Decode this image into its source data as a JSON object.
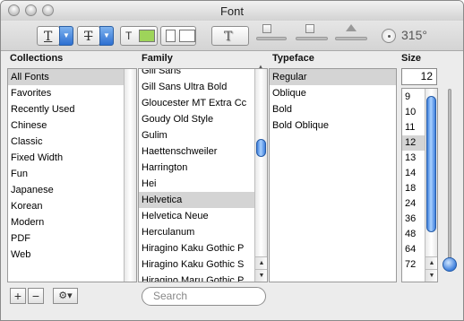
{
  "window": {
    "title": "Font"
  },
  "toolbar": {
    "rotation_label": "315°"
  },
  "columns": {
    "collections": "Collections",
    "family": "Family",
    "typeface": "Typeface",
    "size": "Size"
  },
  "collections": [
    {
      "label": "All Fonts",
      "selected": true
    },
    {
      "label": "Favorites"
    },
    {
      "label": "Recently Used"
    },
    {
      "label": "Chinese"
    },
    {
      "label": "Classic"
    },
    {
      "label": "Fixed Width"
    },
    {
      "label": "Fun"
    },
    {
      "label": "Japanese"
    },
    {
      "label": "Korean"
    },
    {
      "label": "Modern"
    },
    {
      "label": "PDF"
    },
    {
      "label": "Web"
    }
  ],
  "families": [
    {
      "label": "Gill Sans"
    },
    {
      "label": "Gill Sans Ultra Bold"
    },
    {
      "label": "Gloucester MT Extra Cc"
    },
    {
      "label": "Goudy Old Style"
    },
    {
      "label": "Gulim"
    },
    {
      "label": "Haettenschweiler"
    },
    {
      "label": "Harrington"
    },
    {
      "label": "Hei"
    },
    {
      "label": "Helvetica",
      "selected": true
    },
    {
      "label": "Helvetica Neue"
    },
    {
      "label": "Herculanum"
    },
    {
      "label": "Hiragino Kaku Gothic P"
    },
    {
      "label": "Hiragino Kaku Gothic S"
    },
    {
      "label": "Hiragino Maru Gothic P"
    }
  ],
  "typefaces": [
    {
      "label": "Regular",
      "selected": true
    },
    {
      "label": "Oblique"
    },
    {
      "label": "Bold"
    },
    {
      "label": "Bold Oblique"
    }
  ],
  "size": {
    "value": "12",
    "options": [
      {
        "label": "9"
      },
      {
        "label": "10"
      },
      {
        "label": "11"
      },
      {
        "label": "12",
        "selected": true
      },
      {
        "label": "13"
      },
      {
        "label": "14"
      },
      {
        "label": "18"
      },
      {
        "label": "24"
      },
      {
        "label": "36"
      },
      {
        "label": "48"
      },
      {
        "label": "64"
      },
      {
        "label": "72"
      }
    ]
  },
  "bottom": {
    "add_label": "+",
    "remove_label": "−",
    "actions_label": "⚙▾",
    "search_placeholder": "Search"
  },
  "colors": {
    "selection": "#d4d4d4",
    "scroll_thumb": "#3e7fdc",
    "text_color_swatch": "#9ed45a"
  },
  "icons": [
    "close-icon",
    "minimize-icon",
    "zoom-icon",
    "underline-icon",
    "strikethrough-icon",
    "text-color-icon",
    "document-color-icon",
    "shadow-icon",
    "gear-icon",
    "rotation-dial-icon"
  ]
}
